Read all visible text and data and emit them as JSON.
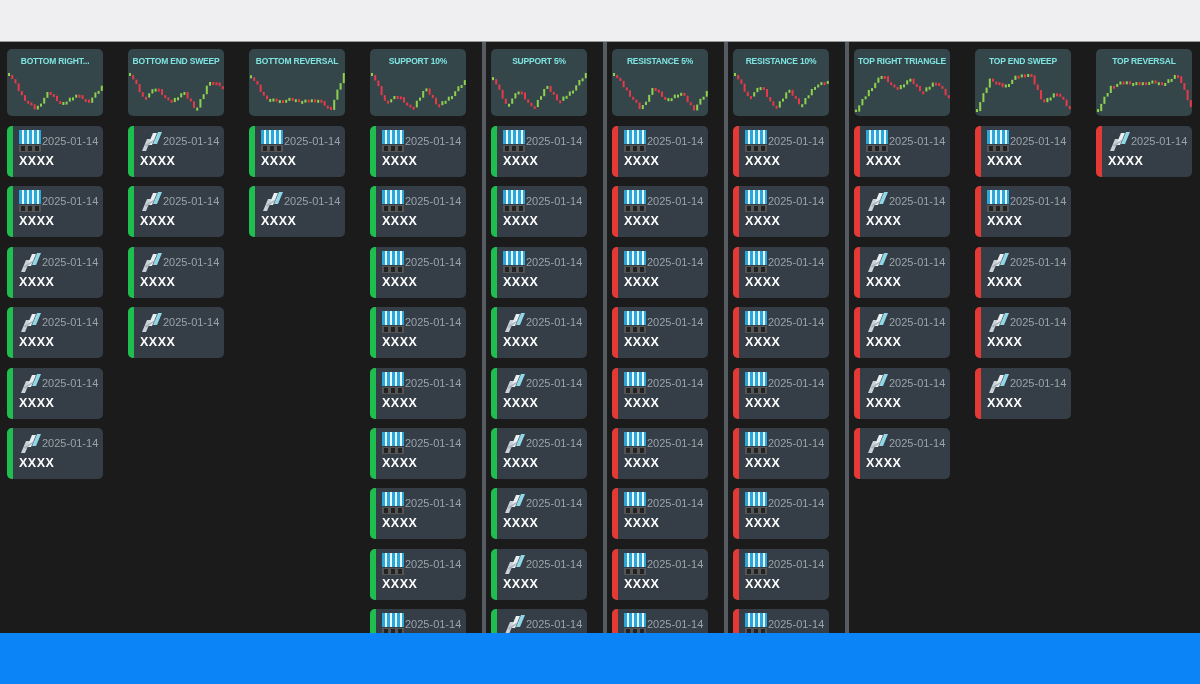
{
  "columns": [
    {
      "title": "BOTTOM RIGHT...",
      "color": "#1fbf4f",
      "divider": false,
      "cards": [
        {
          "kind": "bars",
          "date": "2025-01-14",
          "name": "XXXX"
        },
        {
          "kind": "bars",
          "date": "2025-01-14",
          "name": "XXXX"
        },
        {
          "kind": "wing",
          "date": "2025-01-14",
          "name": "XXXX"
        },
        {
          "kind": "wing",
          "date": "2025-01-14",
          "name": "XXXX"
        },
        {
          "kind": "wing",
          "date": "2025-01-14",
          "name": "XXXX"
        },
        {
          "kind": "wing",
          "date": "2025-01-14",
          "name": "XXXX"
        }
      ]
    },
    {
      "title": "BOTTOM END SWEEP",
      "color": "#1fbf4f",
      "divider": false,
      "cards": [
        {
          "kind": "wing",
          "date": "2025-01-14",
          "name": "XXXX"
        },
        {
          "kind": "wing",
          "date": "2025-01-14",
          "name": "XXXX"
        },
        {
          "kind": "wing",
          "date": "2025-01-14",
          "name": "XXXX"
        },
        {
          "kind": "wing",
          "date": "2025-01-14",
          "name": "XXXX"
        }
      ]
    },
    {
      "title": "BOTTOM REVERSAL",
      "color": "#1fbf4f",
      "divider": false,
      "cards": [
        {
          "kind": "bars",
          "date": "2025-01-14",
          "name": "XXXX"
        },
        {
          "kind": "wing",
          "date": "2025-01-14",
          "name": "XXXX"
        }
      ]
    },
    {
      "title": "SUPPORT 10%",
      "color": "#1fbf4f",
      "divider": false,
      "cards": [
        {
          "kind": "bars",
          "date": "2025-01-14",
          "name": "XXXX"
        },
        {
          "kind": "bars",
          "date": "2025-01-14",
          "name": "XXXX"
        },
        {
          "kind": "bars",
          "date": "2025-01-14",
          "name": "XXXX"
        },
        {
          "kind": "bars",
          "date": "2025-01-14",
          "name": "XXXX"
        },
        {
          "kind": "bars",
          "date": "2025-01-14",
          "name": "XXXX"
        },
        {
          "kind": "bars",
          "date": "2025-01-14",
          "name": "XXXX"
        },
        {
          "kind": "bars",
          "date": "2025-01-14",
          "name": "XXXX"
        },
        {
          "kind": "bars",
          "date": "2025-01-14",
          "name": "XXXX"
        },
        {
          "kind": "bars",
          "date": "2025-01-14"
        }
      ]
    },
    {
      "title": "SUPPORT 5%",
      "color": "#1fbf4f",
      "divider": true,
      "cards": [
        {
          "kind": "bars",
          "date": "2025-01-14",
          "name": "XXXX"
        },
        {
          "kind": "bars",
          "date": "2025-01-14",
          "name": "XXXX"
        },
        {
          "kind": "bars",
          "date": "2025-01-14",
          "name": "XXXX"
        },
        {
          "kind": "wing",
          "date": "2025-01-14",
          "name": "XXXX"
        },
        {
          "kind": "wing",
          "date": "2025-01-14",
          "name": "XXXX"
        },
        {
          "kind": "wing",
          "date": "2025-01-14",
          "name": "XXXX"
        },
        {
          "kind": "wing",
          "date": "2025-01-14",
          "name": "XXXX"
        },
        {
          "kind": "wing",
          "date": "2025-01-14",
          "name": "XXXX"
        },
        {
          "kind": "wing",
          "date": "2025-01-14"
        }
      ]
    },
    {
      "title": "RESISTANCE 5%",
      "color": "#e53935",
      "divider": true,
      "cards": [
        {
          "kind": "bars",
          "date": "2025-01-14",
          "name": "XXXX"
        },
        {
          "kind": "bars",
          "date": "2025-01-14",
          "name": "XXXX"
        },
        {
          "kind": "bars",
          "date": "2025-01-14",
          "name": "XXXX"
        },
        {
          "kind": "bars",
          "date": "2025-01-14",
          "name": "XXXX"
        },
        {
          "kind": "bars",
          "date": "2025-01-14",
          "name": "XXXX"
        },
        {
          "kind": "bars",
          "date": "2025-01-14",
          "name": "XXXX"
        },
        {
          "kind": "bars",
          "date": "2025-01-14",
          "name": "XXXX"
        },
        {
          "kind": "bars",
          "date": "2025-01-14",
          "name": "XXXX"
        },
        {
          "kind": "bars",
          "date": "2025-01-14"
        }
      ]
    },
    {
      "title": "RESISTANCE 10%",
      "color": "#e53935",
      "divider": true,
      "cards": [
        {
          "kind": "bars",
          "date": "2025-01-14",
          "name": "XXXX"
        },
        {
          "kind": "bars",
          "date": "2025-01-14",
          "name": "XXXX"
        },
        {
          "kind": "bars",
          "date": "2025-01-14",
          "name": "XXXX"
        },
        {
          "kind": "bars",
          "date": "2025-01-14",
          "name": "XXXX"
        },
        {
          "kind": "bars",
          "date": "2025-01-14",
          "name": "XXXX"
        },
        {
          "kind": "bars",
          "date": "2025-01-14",
          "name": "XXXX"
        },
        {
          "kind": "bars",
          "date": "2025-01-14",
          "name": "XXXX"
        },
        {
          "kind": "bars",
          "date": "2025-01-14",
          "name": "XXXX"
        },
        {
          "kind": "bars",
          "date": "2025-01-14"
        }
      ]
    },
    {
      "title": "TOP RIGHT TRIANGLE",
      "color": "#e53935",
      "divider": true,
      "cards": [
        {
          "kind": "bars",
          "date": "2025-01-14",
          "name": "XXXX"
        },
        {
          "kind": "wing",
          "date": "2025-01-14",
          "name": "XXXX"
        },
        {
          "kind": "wing",
          "date": "2025-01-14",
          "name": "XXXX"
        },
        {
          "kind": "wing",
          "date": "2025-01-14",
          "name": "XXXX"
        },
        {
          "kind": "wing",
          "date": "2025-01-14",
          "name": "XXXX"
        },
        {
          "kind": "wing",
          "date": "2025-01-14",
          "name": "XXXX"
        }
      ]
    },
    {
      "title": "TOP END SWEEP",
      "color": "#e53935",
      "divider": false,
      "cards": [
        {
          "kind": "bars",
          "date": "2025-01-14",
          "name": "XXXX"
        },
        {
          "kind": "bars",
          "date": "2025-01-14",
          "name": "XXXX"
        },
        {
          "kind": "wing",
          "date": "2025-01-14",
          "name": "XXXX"
        },
        {
          "kind": "wing",
          "date": "2025-01-14",
          "name": "XXXX"
        },
        {
          "kind": "wing",
          "date": "2025-01-14",
          "name": "XXXX"
        }
      ]
    },
    {
      "title": "TOP REVERSAL",
      "color": "#e53935",
      "divider": false,
      "cards": [
        {
          "kind": "wing",
          "date": "2025-01-14",
          "name": "XXXX"
        }
      ]
    }
  ]
}
